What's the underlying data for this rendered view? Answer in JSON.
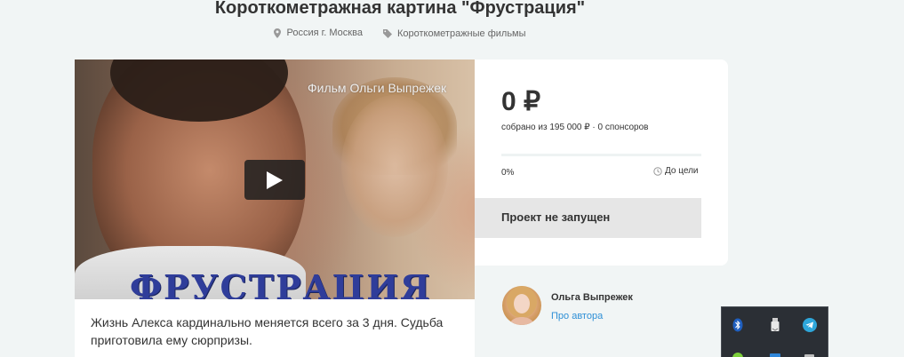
{
  "page": {
    "title": "Короткометражная картина \"Фрустрация\"",
    "location": "Россия г. Москва",
    "category": "Короткометражные фильмы"
  },
  "video": {
    "caption": "Фильм Ольги Выпрежек",
    "logo_text": "ФРУСТРАЦИЯ"
  },
  "description": "Жизнь Алекса кардинально меняется всего за 3 дня. Судьба приготовила ему сюрпризы.",
  "funding": {
    "amount": "0 ₽",
    "collected_text": "собрано из 195 000 ₽ · 0 спонсоров",
    "percent_label": "0%",
    "progress_fraction": 0,
    "to_goal_label": "До цели",
    "status": "Проект не запущен",
    "accent_color": "#2aa3de"
  },
  "author": {
    "name": "Ольга Выпрежек",
    "link_label": "Про автора"
  },
  "tray": {
    "icons": [
      "bluetooth-icon",
      "usb-drive-icon",
      "telegram-icon",
      "green-app-icon",
      "network-icon",
      "battery-icon"
    ]
  }
}
